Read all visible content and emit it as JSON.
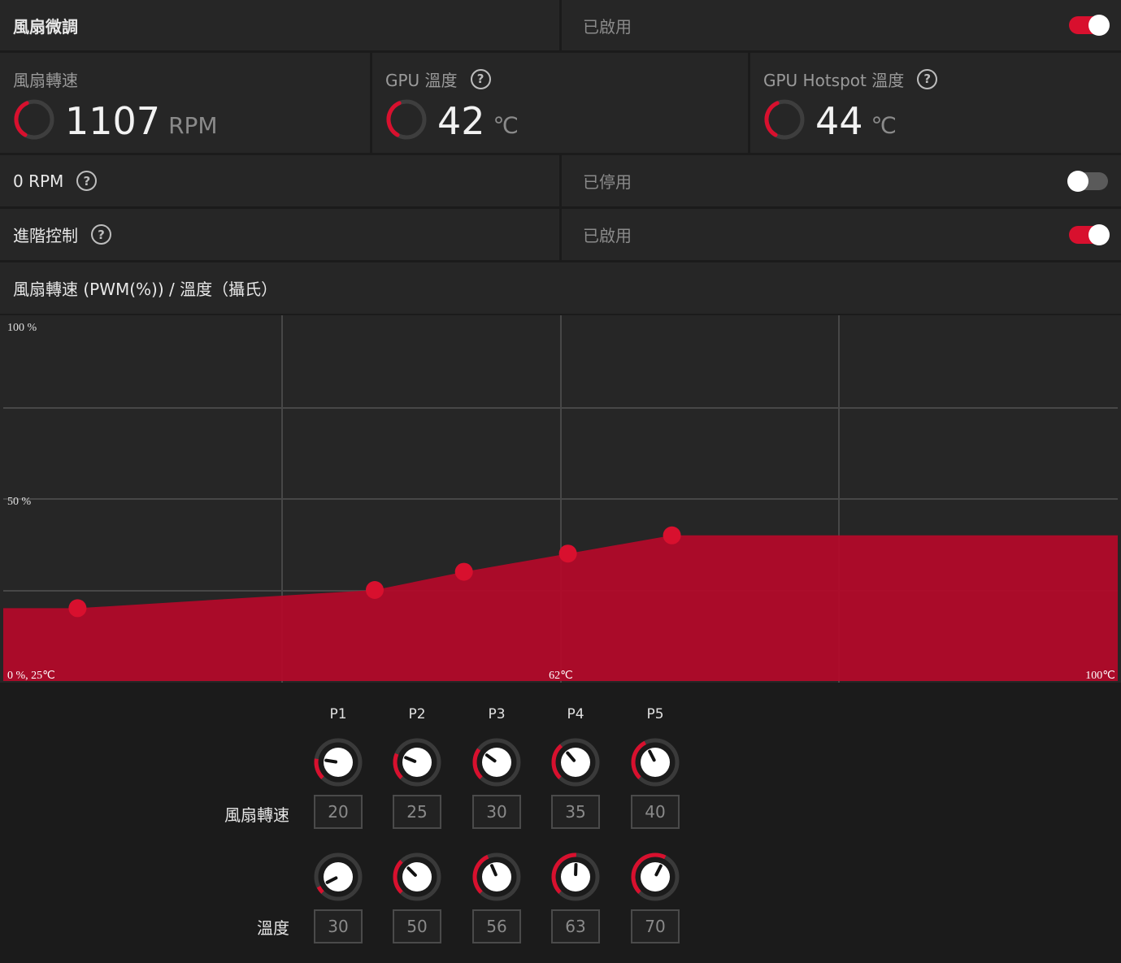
{
  "header": {
    "title": "風扇微調",
    "status": "已啟用",
    "enabled": true
  },
  "metrics": [
    {
      "title": "風扇轉速",
      "value": "1107",
      "unit": "RPM",
      "help": false,
      "gauge_fraction": 0.35
    },
    {
      "title": "GPU 溫度",
      "value": "42",
      "unit": "℃",
      "help": true,
      "gauge_fraction": 0.35
    },
    {
      "title": "GPU Hotspot 溫度",
      "value": "44",
      "unit": "℃",
      "help": true,
      "gauge_fraction": 0.35
    }
  ],
  "zero_rpm": {
    "label": "0 RPM",
    "status": "已停用",
    "enabled": false
  },
  "advanced": {
    "label": "進階控制",
    "status": "已啟用",
    "enabled": true
  },
  "curve_title": "風扇轉速 (PWM(%)) / 溫度（攝氏）",
  "help_glyph": "?",
  "colors": {
    "accent": "#d8102e",
    "fill": "#b00a2a",
    "panel": "#262626",
    "background": "#1b1b1b"
  },
  "chart_data": {
    "type": "area",
    "x_unit": "°C",
    "y_unit": "%",
    "xlim": [
      25,
      100
    ],
    "ylim": [
      0,
      100
    ],
    "x": [
      30,
      50,
      56,
      63,
      70
    ],
    "y": [
      20,
      25,
      30,
      35,
      40
    ],
    "tick_labels": {
      "y_top": "100 %",
      "y_mid": "50 %",
      "origin": "0 %, 25℃",
      "x_mid": "62℃",
      "x_max": "100℃"
    },
    "grid": true
  },
  "points": {
    "labels": [
      "P1",
      "P2",
      "P3",
      "P4",
      "P5"
    ],
    "fan_label": "風扇轉速",
    "temp_label": "溫度",
    "fan_values": [
      "20",
      "25",
      "30",
      "35",
      "40"
    ],
    "temp_values": [
      "30",
      "50",
      "56",
      "63",
      "70"
    ]
  }
}
